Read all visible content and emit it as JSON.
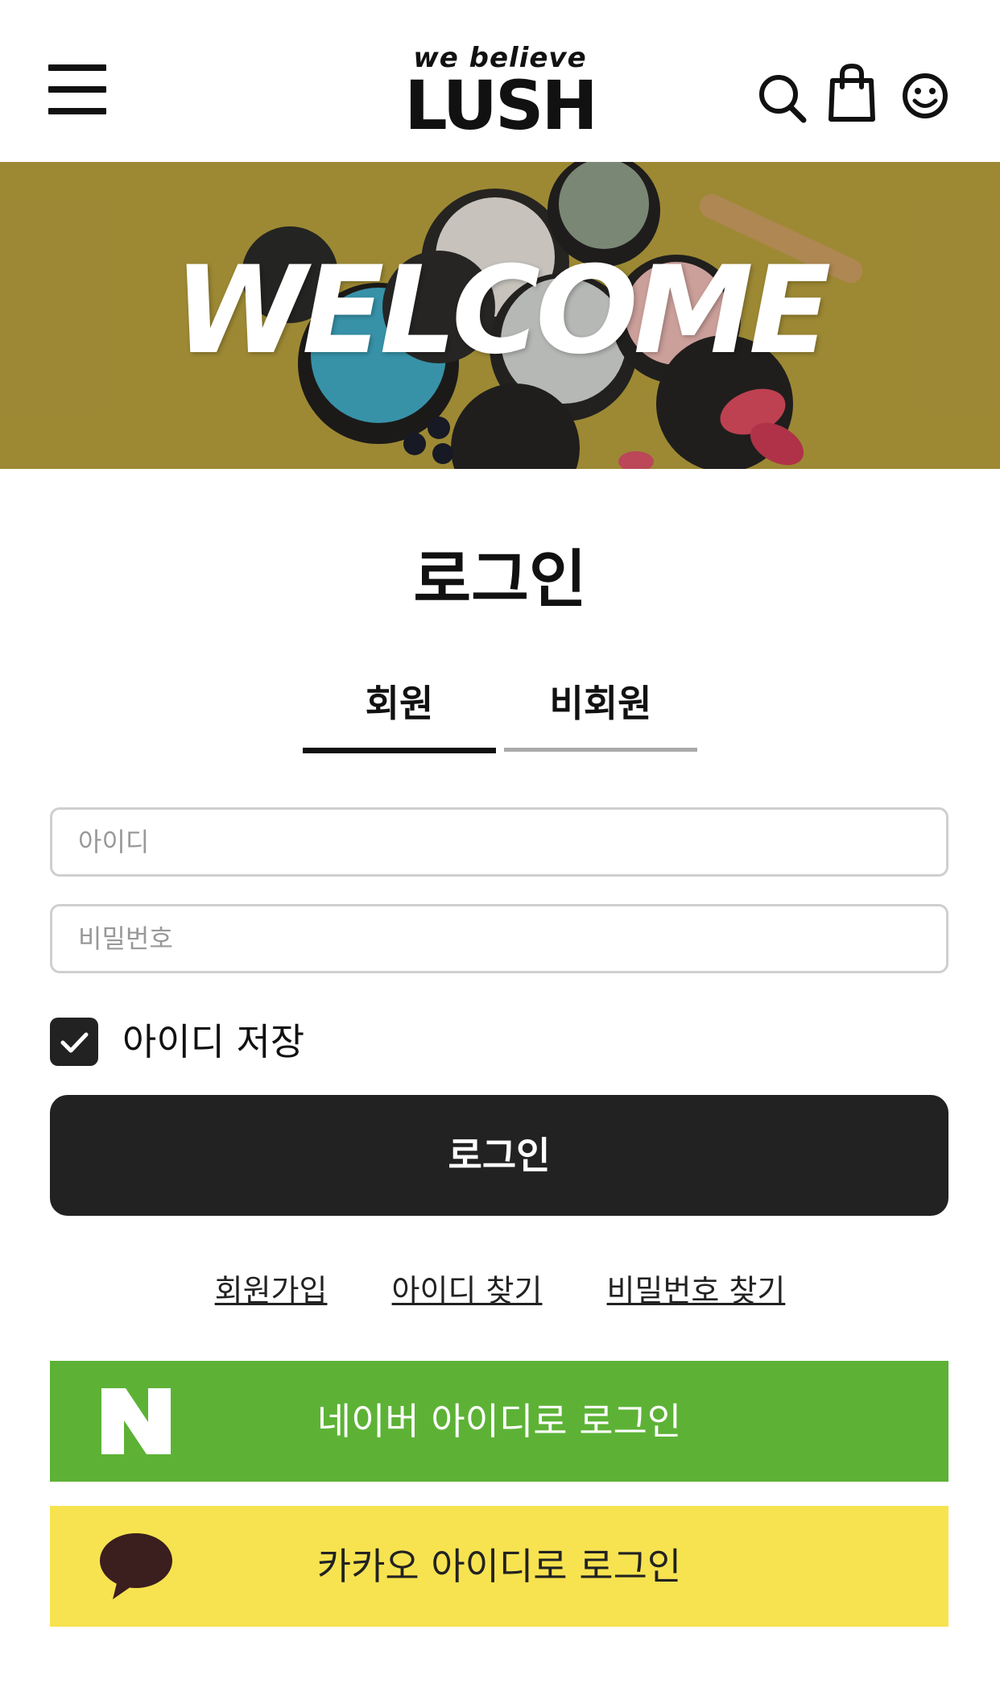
{
  "header": {
    "tagline": "we believe",
    "brand": "LUSH",
    "icons": [
      "menu-icon",
      "search-icon",
      "shopping-bag-icon",
      "smiley-account-icon"
    ]
  },
  "banner": {
    "text": "WELCOME"
  },
  "page": {
    "title": "로그인"
  },
  "tabs": [
    {
      "label": "회원",
      "active": true
    },
    {
      "label": "비회원",
      "active": false
    }
  ],
  "form": {
    "id_placeholder": "아이디",
    "id_value": "",
    "password_placeholder": "비밀번호",
    "password_value": "",
    "save_id_label": "아이디 저장",
    "save_id_checked": true,
    "login_button": "로그인"
  },
  "links": {
    "signup": "회원가입",
    "find_id": "아이디 찾기",
    "find_password": "비밀번호 찾기"
  },
  "social": {
    "naver_label": "네이버 아이디로 로그인",
    "kakao_label": "카카오 아이디로 로그인",
    "naver_color": "#5db236",
    "kakao_color": "#f7e350"
  },
  "colors": {
    "primary_dark": "#222222",
    "banner_bg": "#b09a3a"
  }
}
